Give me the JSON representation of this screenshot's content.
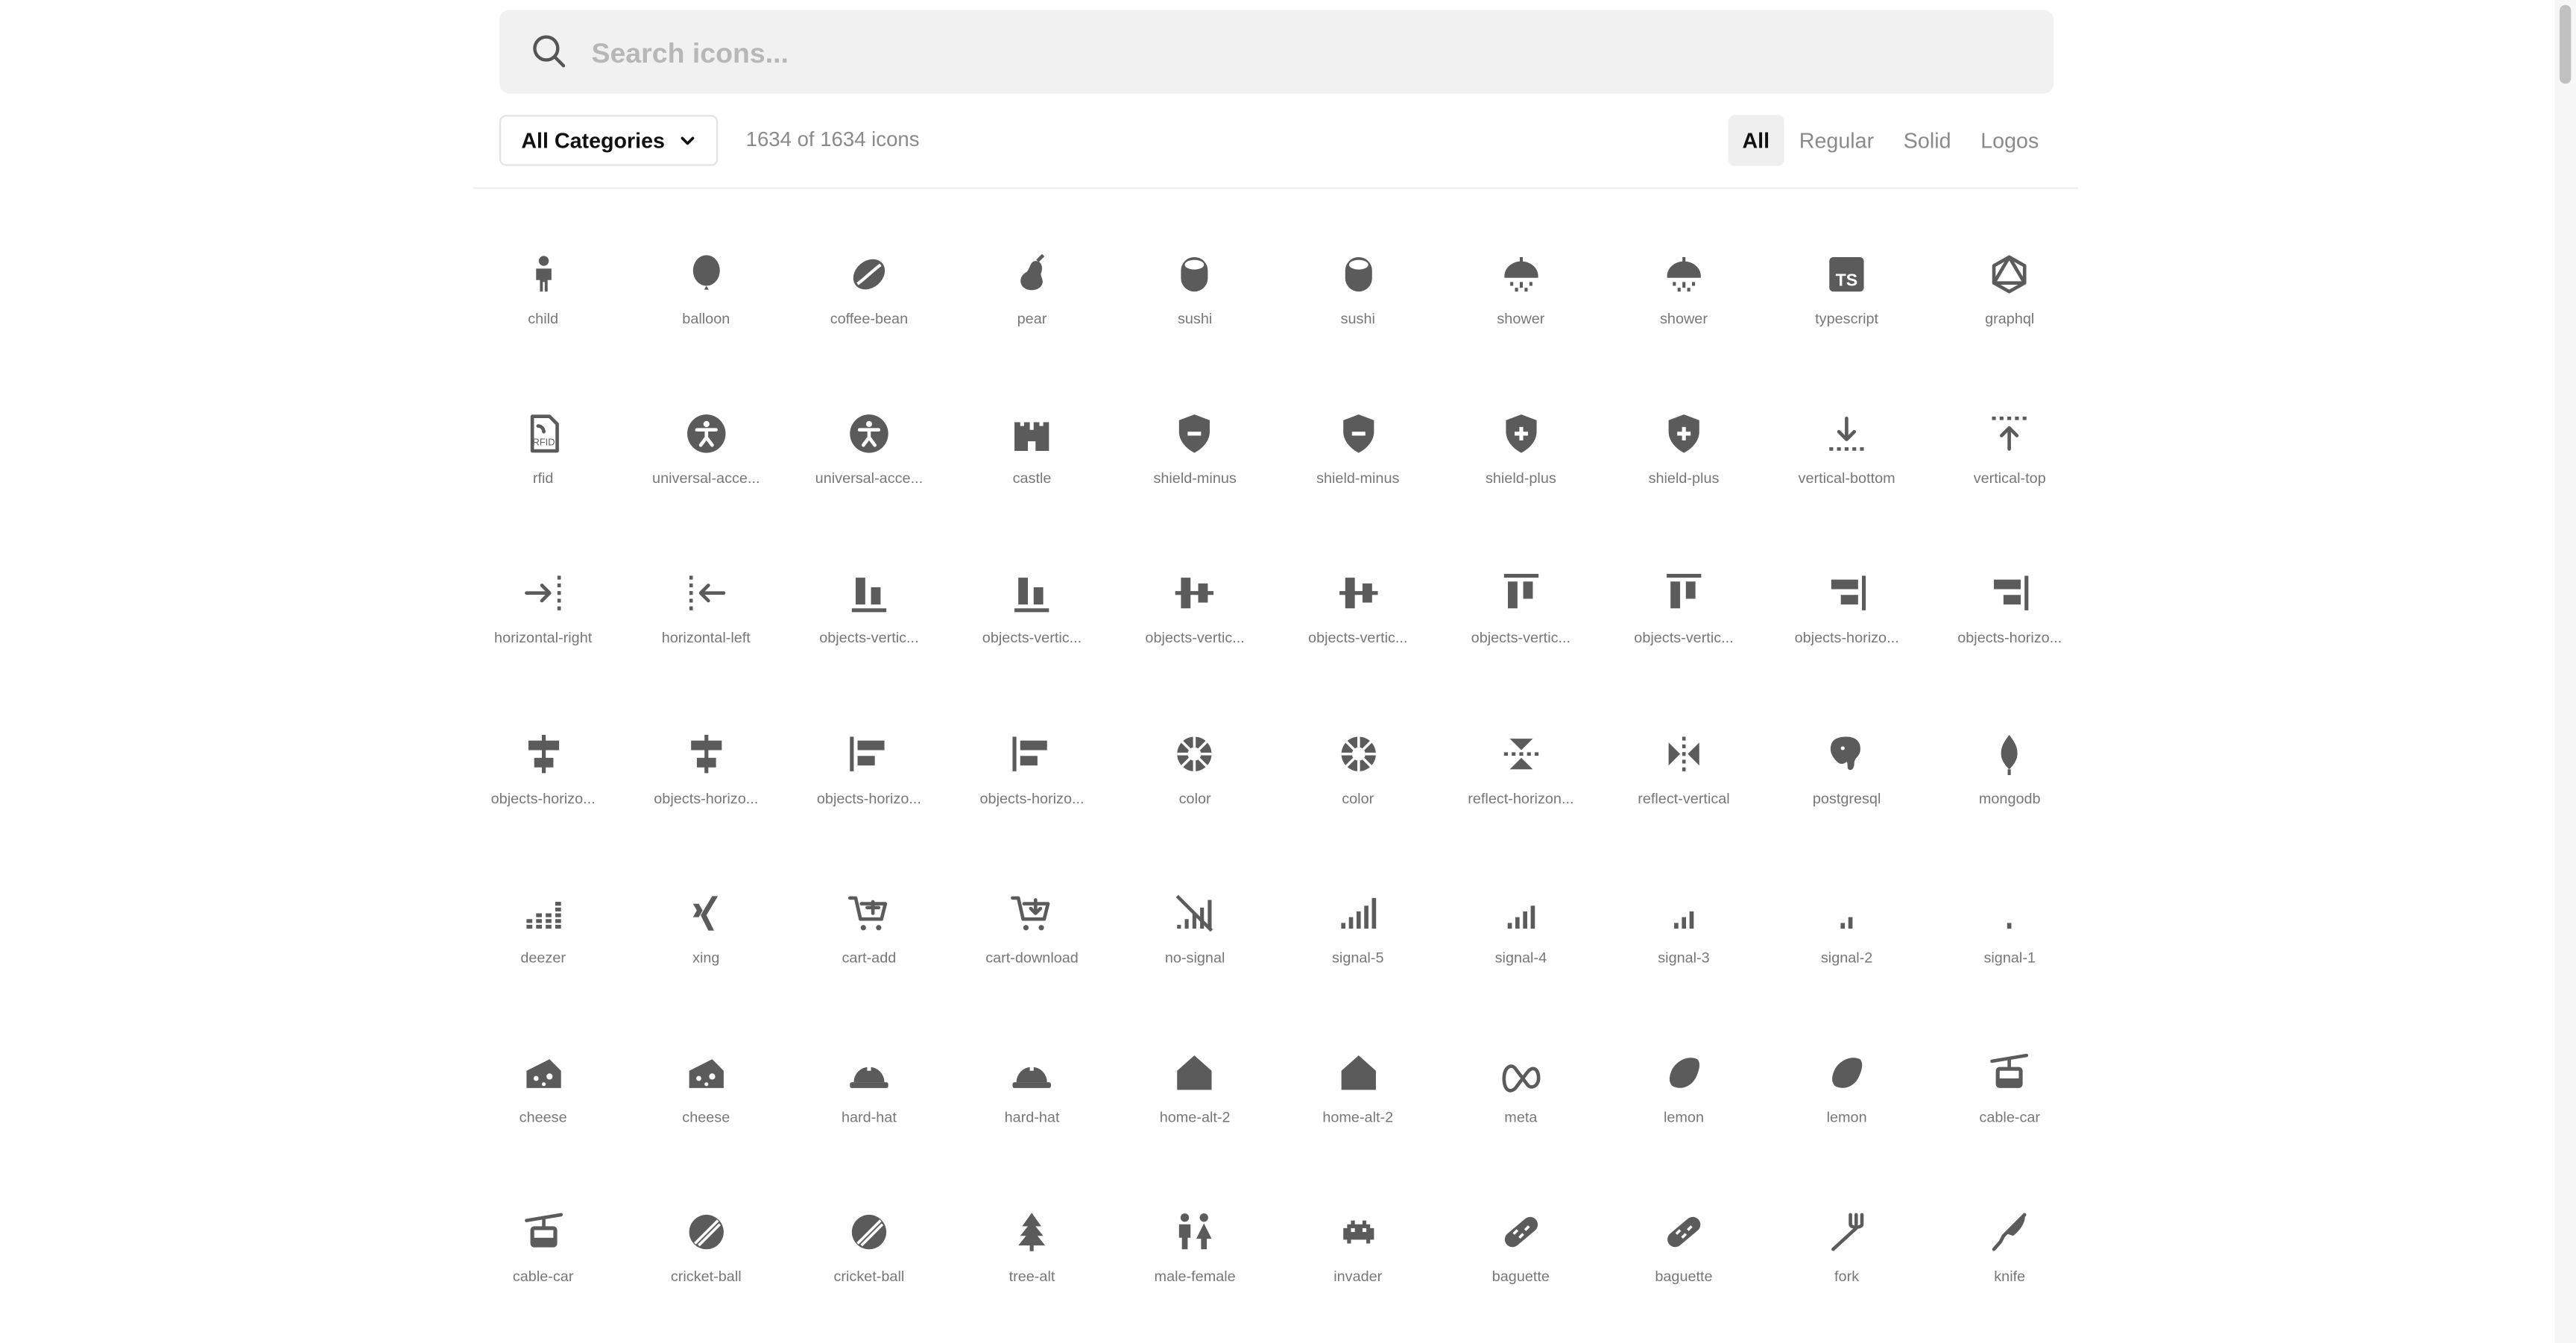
{
  "search": {
    "placeholder": "Search icons...",
    "icon": "search-icon"
  },
  "toolbar": {
    "category_label": "All Categories",
    "count_text": "1634 of 1634 icons",
    "filters": [
      "All",
      "Regular",
      "Solid",
      "Logos"
    ],
    "active_filter": "All"
  },
  "icon_color": "#5b5b5b",
  "icons": [
    {
      "label": "child",
      "icon": "child-icon"
    },
    {
      "label": "balloon",
      "icon": "balloon-icon"
    },
    {
      "label": "coffee-bean",
      "icon": "coffee-bean-icon"
    },
    {
      "label": "pear",
      "icon": "pear-icon"
    },
    {
      "label": "sushi",
      "icon": "sushi-icon"
    },
    {
      "label": "sushi",
      "icon": "sushi-icon"
    },
    {
      "label": "shower",
      "icon": "shower-icon"
    },
    {
      "label": "shower",
      "icon": "shower-icon"
    },
    {
      "label": "typescript",
      "icon": "typescript-icon"
    },
    {
      "label": "graphql",
      "icon": "graphql-icon"
    },
    {
      "label": "rfid",
      "icon": "rfid-icon"
    },
    {
      "label": "universal-acce...",
      "icon": "universal-access-icon"
    },
    {
      "label": "universal-acce...",
      "icon": "universal-access-icon"
    },
    {
      "label": "castle",
      "icon": "castle-icon"
    },
    {
      "label": "shield-minus",
      "icon": "shield-minus-icon"
    },
    {
      "label": "shield-minus",
      "icon": "shield-minus-icon"
    },
    {
      "label": "shield-plus",
      "icon": "shield-plus-icon"
    },
    {
      "label": "shield-plus",
      "icon": "shield-plus-icon"
    },
    {
      "label": "vertical-bottom",
      "icon": "vertical-bottom-icon"
    },
    {
      "label": "vertical-top",
      "icon": "vertical-top-icon"
    },
    {
      "label": "horizontal-right",
      "icon": "horizontal-right-icon"
    },
    {
      "label": "horizontal-left",
      "icon": "horizontal-left-icon"
    },
    {
      "label": "objects-vertic...",
      "icon": "objects-vertical-bottom-icon"
    },
    {
      "label": "objects-vertic...",
      "icon": "objects-vertical-bottom-icon"
    },
    {
      "label": "objects-vertic...",
      "icon": "objects-vertical-center-icon"
    },
    {
      "label": "objects-vertic...",
      "icon": "objects-vertical-center-icon"
    },
    {
      "label": "objects-vertic...",
      "icon": "objects-vertical-top-icon"
    },
    {
      "label": "objects-vertic...",
      "icon": "objects-vertical-top-icon"
    },
    {
      "label": "objects-horizo...",
      "icon": "objects-horizontal-right-icon"
    },
    {
      "label": "objects-horizo...",
      "icon": "objects-horizontal-right-icon"
    },
    {
      "label": "objects-horizo...",
      "icon": "objects-horizontal-center-icon"
    },
    {
      "label": "objects-horizo...",
      "icon": "objects-horizontal-center-icon"
    },
    {
      "label": "objects-horizo...",
      "icon": "objects-horizontal-left-icon"
    },
    {
      "label": "objects-horizo...",
      "icon": "objects-horizontal-left-icon"
    },
    {
      "label": "color",
      "icon": "color-icon"
    },
    {
      "label": "color",
      "icon": "color-icon"
    },
    {
      "label": "reflect-horizon...",
      "icon": "reflect-horizontal-icon"
    },
    {
      "label": "reflect-vertical",
      "icon": "reflect-vertical-icon"
    },
    {
      "label": "postgresql",
      "icon": "postgresql-icon"
    },
    {
      "label": "mongodb",
      "icon": "mongodb-icon"
    },
    {
      "label": "deezer",
      "icon": "deezer-icon"
    },
    {
      "label": "xing",
      "icon": "xing-icon"
    },
    {
      "label": "cart-add",
      "icon": "cart-add-icon"
    },
    {
      "label": "cart-download",
      "icon": "cart-download-icon"
    },
    {
      "label": "no-signal",
      "icon": "no-signal-icon"
    },
    {
      "label": "signal-5",
      "icon": "signal-5-icon"
    },
    {
      "label": "signal-4",
      "icon": "signal-4-icon"
    },
    {
      "label": "signal-3",
      "icon": "signal-3-icon"
    },
    {
      "label": "signal-2",
      "icon": "signal-2-icon"
    },
    {
      "label": "signal-1",
      "icon": "signal-1-icon"
    },
    {
      "label": "cheese",
      "icon": "cheese-icon"
    },
    {
      "label": "cheese",
      "icon": "cheese-icon"
    },
    {
      "label": "hard-hat",
      "icon": "hard-hat-icon"
    },
    {
      "label": "hard-hat",
      "icon": "hard-hat-icon"
    },
    {
      "label": "home-alt-2",
      "icon": "home-icon"
    },
    {
      "label": "home-alt-2",
      "icon": "home-icon"
    },
    {
      "label": "meta",
      "icon": "meta-icon"
    },
    {
      "label": "lemon",
      "icon": "lemon-icon"
    },
    {
      "label": "lemon",
      "icon": "lemon-icon"
    },
    {
      "label": "cable-car",
      "icon": "cable-car-icon"
    },
    {
      "label": "cable-car",
      "icon": "cable-car-icon"
    },
    {
      "label": "cricket-ball",
      "icon": "cricket-ball-icon"
    },
    {
      "label": "cricket-ball",
      "icon": "cricket-ball-icon"
    },
    {
      "label": "tree-alt",
      "icon": "tree-icon"
    },
    {
      "label": "male-female",
      "icon": "male-female-icon"
    },
    {
      "label": "invader",
      "icon": "invader-icon"
    },
    {
      "label": "baguette",
      "icon": "baguette-icon"
    },
    {
      "label": "baguette",
      "icon": "baguette-icon"
    },
    {
      "label": "fork",
      "icon": "fork-icon"
    },
    {
      "label": "knife",
      "icon": "knife-icon"
    }
  ]
}
